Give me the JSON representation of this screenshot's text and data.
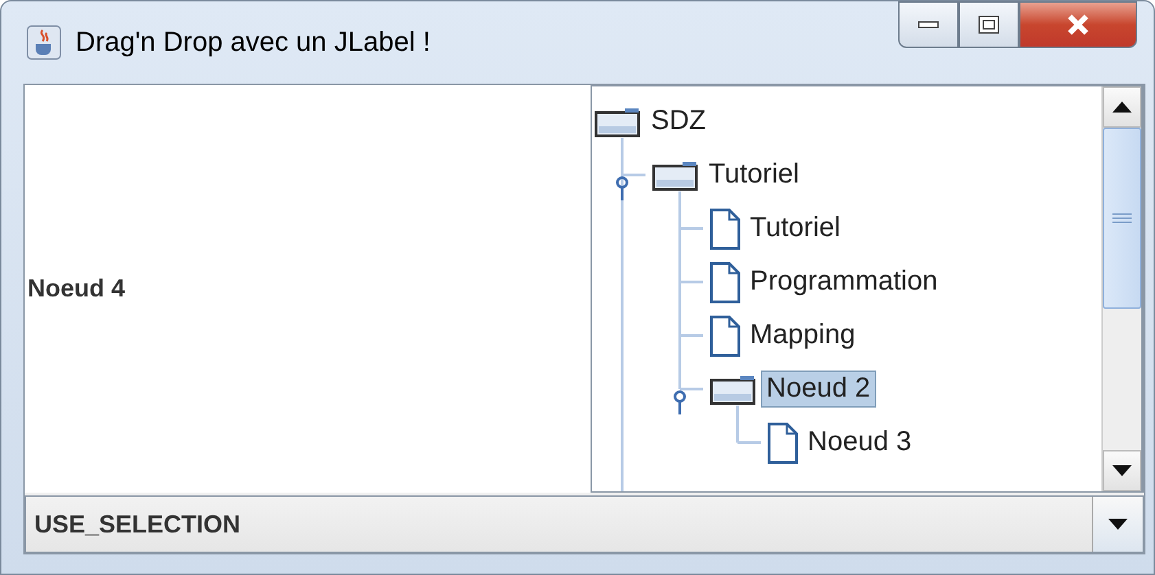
{
  "window": {
    "title": "Drag'n Drop avec un JLabel !"
  },
  "label": {
    "text": "Noeud 4"
  },
  "tree": {
    "root": {
      "label": "SDZ",
      "kind": "folder",
      "selected": false,
      "children": [
        {
          "label": "Tutoriel",
          "kind": "folder",
          "selected": false,
          "expanded": true,
          "children": [
            {
              "label": "Tutoriel",
              "kind": "file",
              "selected": false
            },
            {
              "label": "Programmation",
              "kind": "file",
              "selected": false
            },
            {
              "label": "Mapping",
              "kind": "file",
              "selected": false
            },
            {
              "label": "Noeud 2",
              "kind": "folder",
              "selected": true,
              "expanded": true,
              "children": [
                {
                  "label": "Noeud 3",
                  "kind": "file",
                  "selected": false
                }
              ]
            }
          ]
        }
      ]
    }
  },
  "combo": {
    "value": "USE_SELECTION"
  }
}
